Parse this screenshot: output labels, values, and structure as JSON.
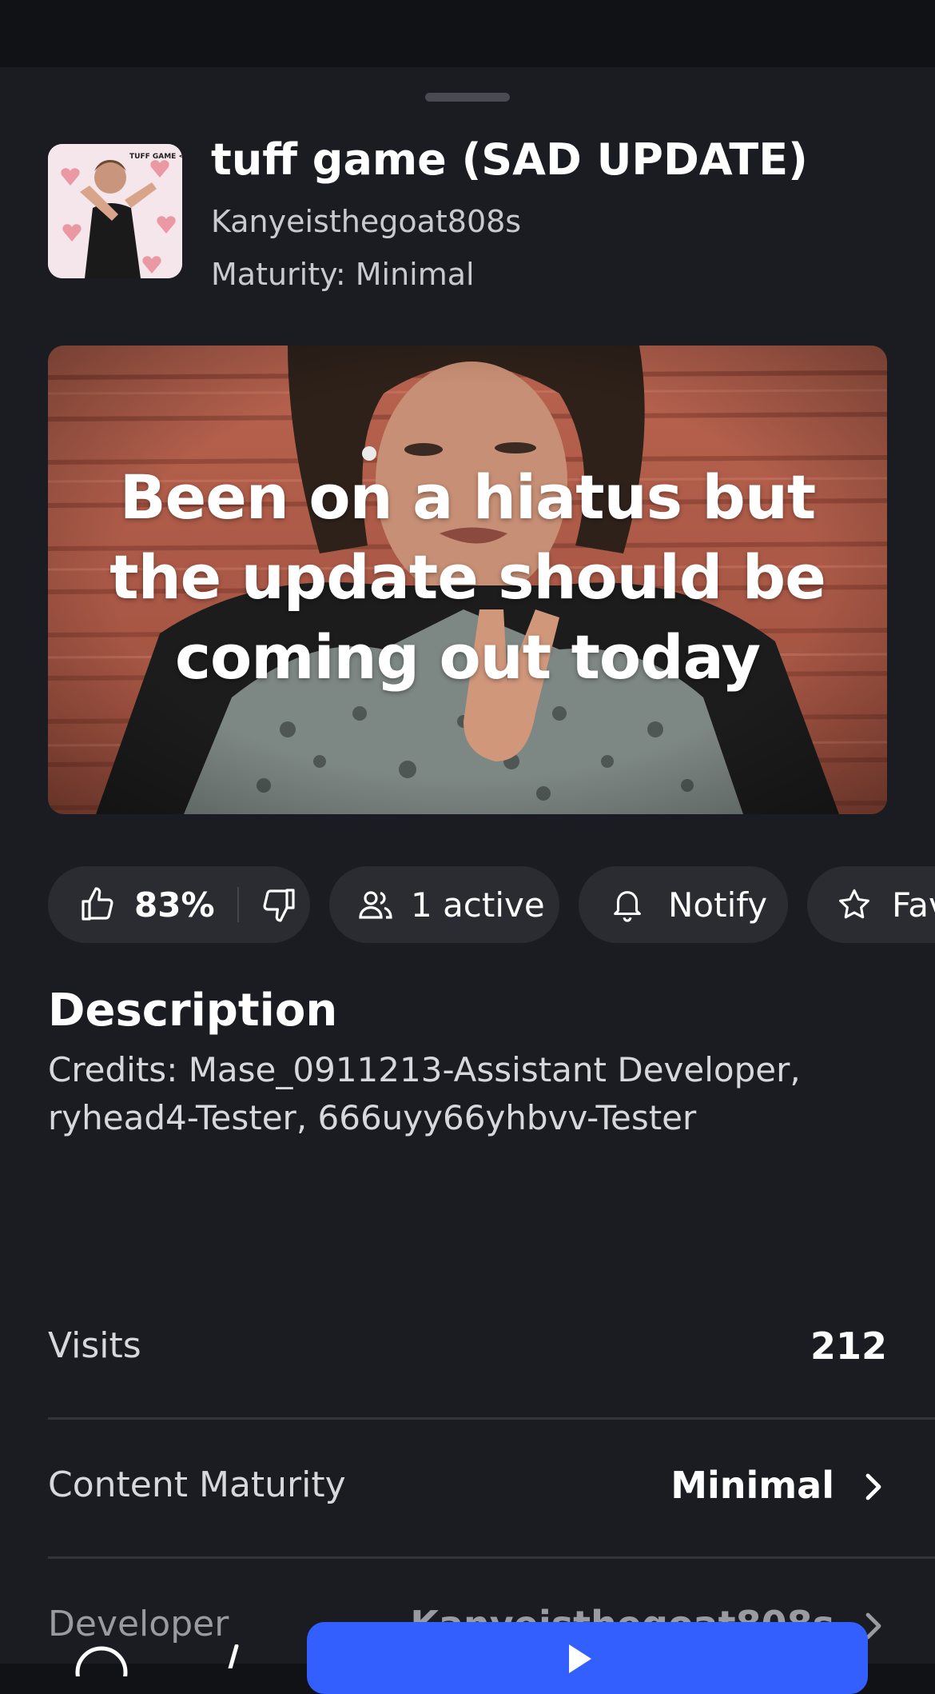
{
  "game": {
    "title": "tuff game (SAD UPDATE)",
    "creator": "Kanyeisthegoat808s",
    "maturity_line": "Maturity: Minimal",
    "thumbnail_caption": "TUFF GAME <3"
  },
  "banner": {
    "caption": "Been on a hiatus but the update should be coming out today"
  },
  "actions": {
    "rating": "83%",
    "active": "1 active",
    "notify": "Notify",
    "favorite": "Fav"
  },
  "description": {
    "heading": "Description",
    "text": "Credits: Mase_0911213-Assistant Developer, ryhead4-Tester, 666uyy66yhbvv-Tester"
  },
  "info": {
    "visits_label": "Visits",
    "visits_value": "212",
    "maturity_label": "Content Maturity",
    "maturity_value": "Minimal",
    "developer_label": "Developer",
    "developer_value": "Kanyeisthegoat808s"
  },
  "colors": {
    "background": "#1b1c21",
    "pill": "#2b2c32",
    "play_button": "#335fff"
  }
}
